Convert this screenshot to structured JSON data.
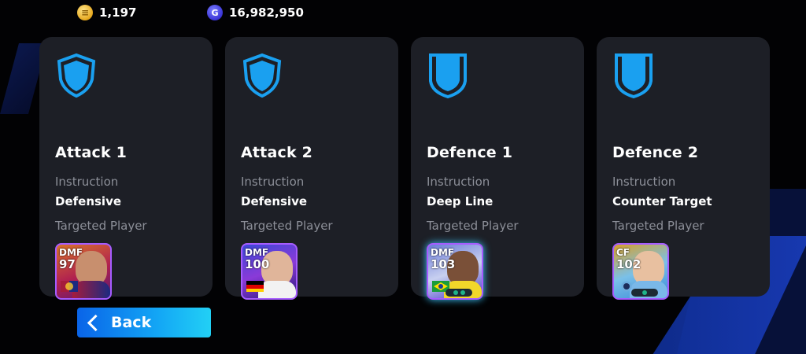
{
  "currency": {
    "coins": "1,197",
    "gp": "16,982,950",
    "coin_icon": "coin-icon",
    "gp_icon": "gp-icon",
    "gp_symbol": "G"
  },
  "cards": [
    {
      "title": "Attack 1",
      "instruction_label": "Instruction",
      "instruction_value": "Defensive",
      "target_label": "Targeted Player",
      "shield_icon": "shield-icon",
      "player": {
        "position": "DMF",
        "rating": "97"
      }
    },
    {
      "title": "Attack 2",
      "instruction_label": "Instruction",
      "instruction_value": "Defensive",
      "target_label": "Targeted Player",
      "shield_icon": "shield-icon",
      "player": {
        "position": "DMF",
        "rating": "100"
      }
    },
    {
      "title": "Defence 1",
      "instruction_label": "Instruction",
      "instruction_value": "Deep Line",
      "target_label": "Targeted Player",
      "shield_icon": "crest-icon",
      "player": {
        "position": "DMF",
        "rating": "103"
      }
    },
    {
      "title": "Defence 2",
      "instruction_label": "Instruction",
      "instruction_value": "Counter Target",
      "target_label": "Targeted Player",
      "shield_icon": "crest-icon",
      "player": {
        "position": "CF",
        "rating": "102"
      }
    }
  ],
  "back_button": {
    "label": "Back",
    "icon": "chevron-left-icon"
  },
  "colors": {
    "card_bg": "#1d1f26",
    "accent_blue": "#13a6f5",
    "shield_blue": "#1aa0f0",
    "player_border": "#a65cff"
  }
}
